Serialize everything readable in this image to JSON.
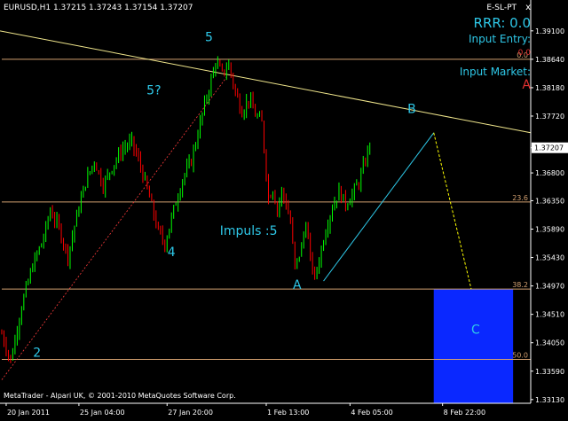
{
  "chart_data": {
    "type": "candlestick",
    "title": "EURUSD,H1  1.37215 1.37243 1.37154 1.37207",
    "symbol": "EURUSD",
    "timeframe": "H1",
    "ohlc": {
      "open": 1.37215,
      "high": 1.37243,
      "low": 1.37154,
      "close": 1.37207
    },
    "ylim": [
      1.3307,
      1.3937
    ],
    "yticks": [
      "1.39100",
      "1.38640",
      "1.38180",
      "1.37720",
      "1.37207",
      "1.36800",
      "1.36350",
      "1.35890",
      "1.35430",
      "1.34970",
      "1.34510",
      "1.34050",
      "1.33590",
      "1.33130"
    ],
    "xticks": [
      "20 Jan 2011",
      "25 Jan 04:00",
      "27 Jan 20:00",
      "1 Feb 13:00",
      "4 Feb 05:00",
      "8 Feb 22:00"
    ],
    "bid_price": 1.37207,
    "price_path": [
      [
        0,
        1.342
      ],
      [
        4,
        1.3375
      ],
      [
        9,
        1.3465
      ],
      [
        14,
        1.353
      ],
      [
        19,
        1.3575
      ],
      [
        22,
        1.362
      ],
      [
        26,
        1.359
      ],
      [
        30,
        1.3545
      ],
      [
        34,
        1.361
      ],
      [
        38,
        1.3665
      ],
      [
        42,
        1.37
      ],
      [
        46,
        1.366
      ],
      [
        50,
        1.369
      ],
      [
        55,
        1.372
      ],
      [
        59,
        1.373
      ],
      [
        63,
        1.369
      ],
      [
        67,
        1.364
      ],
      [
        71,
        1.3585
      ],
      [
        74,
        1.3565
      ],
      [
        78,
        1.362
      ],
      [
        82,
        1.367
      ],
      [
        86,
        1.37
      ],
      [
        89,
        1.3745
      ],
      [
        92,
        1.379
      ],
      [
        95,
        1.383
      ],
      [
        97,
        1.386
      ],
      [
        100,
        1.384
      ],
      [
        103,
        1.3855
      ],
      [
        106,
        1.381
      ],
      [
        109,
        1.378
      ],
      [
        112,
        1.38
      ],
      [
        115,
        1.3775
      ],
      [
        118,
        1.376
      ],
      [
        121,
        1.364
      ],
      [
        123,
        1.3655
      ],
      [
        125,
        1.362
      ],
      [
        127,
        1.365
      ],
      [
        129,
        1.363
      ],
      [
        131,
        1.36
      ],
      [
        133,
        1.3525
      ],
      [
        136,
        1.356
      ],
      [
        138,
        1.36
      ],
      [
        140,
        1.354
      ],
      [
        142,
        1.351
      ],
      [
        144,
        1.354
      ],
      [
        147,
        1.359
      ],
      [
        150,
        1.3625
      ],
      [
        153,
        1.365
      ],
      [
        156,
        1.363
      ],
      [
        159,
        1.3645
      ],
      [
        162,
        1.3665
      ],
      [
        165,
        1.37
      ],
      [
        167,
        1.373
      ]
    ],
    "fib_levels": [
      {
        "label": "0.0",
        "price": 1.3864
      },
      {
        "label": "23.6",
        "price": 1.3633
      },
      {
        "label": "38.2",
        "price": 1.3492
      },
      {
        "label": "50.0",
        "price": 1.3378
      }
    ],
    "wave_labels": [
      {
        "text": "2",
        "t": 16,
        "price": 1.3382
      },
      {
        "text": "4",
        "t": 77,
        "price": 1.3545
      },
      {
        "text": "5?",
        "t": 69,
        "price": 1.3807
      },
      {
        "text": "5",
        "t": 94,
        "price": 1.3893
      },
      {
        "text": "Impuls :5",
        "t": 112,
        "price": 1.358
      },
      {
        "text": "A",
        "t": 134,
        "price": 1.3492
      },
      {
        "text": "B",
        "t": 186,
        "price": 1.3777
      },
      {
        "text": "C",
        "t": 215,
        "price": 1.342
      }
    ],
    "projection_zone": {
      "t_start": 196,
      "t_end": 232,
      "price_high": 1.3492,
      "price_low": 1.3307
    },
    "colors": {
      "background": "#000000",
      "bull": "#00ff00",
      "bear": "#ff0000",
      "wave_label": "#2ec8e8",
      "trendline": "#f0e68c",
      "projection_box": "#0a28ff",
      "fib": "#d2a070"
    }
  },
  "indicator": {
    "name": "E-SL-PT",
    "close_glyph": "x",
    "rrr": "RRR: 0.0",
    "input_entry": "Input Entry:",
    "sl_value": "0.0",
    "input_market": "Input Market:",
    "market_flag": "A"
  },
  "footer": {
    "copyright": "MetaTrader - Alpari UK, © 2001-2010 MetaQuotes Software Corp."
  }
}
